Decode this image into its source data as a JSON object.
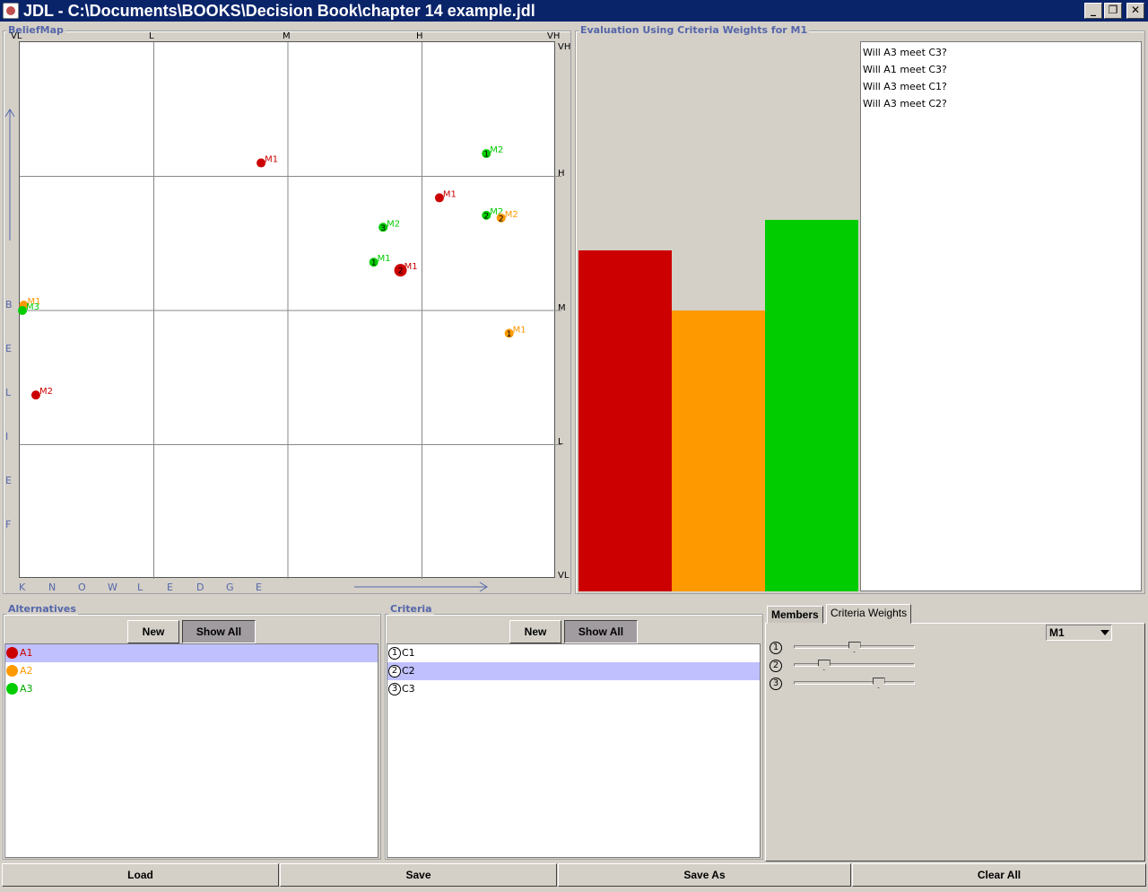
{
  "window": {
    "title": "JDL - C:\\Documents\\BOOKS\\Decision Book\\chapter 14 example.jdl",
    "minimize": "_",
    "restore": "❐",
    "close": "✕"
  },
  "belief_map": {
    "legend": "BeliefMap",
    "top_axis": [
      "VL",
      "L",
      "M",
      "H",
      "VH"
    ],
    "right_axis": [
      "VH",
      "H",
      "M",
      "L",
      "VL"
    ],
    "left_letters": [
      "B",
      "E",
      "L",
      "I",
      "E",
      "F"
    ],
    "bottom_letters": [
      "K",
      "N",
      "O",
      "W",
      "L",
      "E",
      "D",
      "G",
      "E"
    ],
    "chart_data": {
      "type": "scatter",
      "x_axis_ticks": [
        "VL",
        "L",
        "M",
        "H",
        "VH"
      ],
      "y_axis_ticks": [
        "VH",
        "H",
        "M",
        "L",
        "VL"
      ],
      "xlim": [
        0,
        4
      ],
      "ylim": [
        0,
        4
      ],
      "points": [
        {
          "member": "M1",
          "criterion": "",
          "color": "#cc0000",
          "x": 1.8,
          "y": 3.1
        },
        {
          "member": "M1",
          "criterion": "",
          "color": "#cc0000",
          "x": 3.13,
          "y": 2.84
        },
        {
          "member": "M1",
          "criterion": "2",
          "color": "#cc0000",
          "x": 2.84,
          "y": 2.3,
          "big": true
        },
        {
          "member": "M2",
          "criterion": "",
          "color": "#cc0000",
          "x": 0.12,
          "y": 1.37
        },
        {
          "member": "M2",
          "criterion": "1",
          "color": "#00cc00",
          "x": 3.48,
          "y": 3.17
        },
        {
          "member": "M2",
          "criterion": "2",
          "color": "#00cc00",
          "x": 3.48,
          "y": 2.71
        },
        {
          "member": "M2",
          "criterion": "3",
          "color": "#00cc00",
          "x": 2.71,
          "y": 2.62
        },
        {
          "member": "M1",
          "criterion": "1",
          "color": "#00cc00",
          "x": 2.64,
          "y": 2.36
        },
        {
          "member": "M2",
          "criterion": "2",
          "color": "#ff9900",
          "x": 3.59,
          "y": 2.69
        },
        {
          "member": "M1",
          "criterion": "1",
          "color": "#ff9900",
          "x": 3.65,
          "y": 1.83
        },
        {
          "member": "M1",
          "criterion": "",
          "color": "#ff9900",
          "x": 0.03,
          "y": 2.04
        },
        {
          "member": "M3",
          "criterion": "",
          "color": "#00cc00",
          "x": 0.02,
          "y": 2.0
        }
      ]
    }
  },
  "evaluation": {
    "legend": "Evaluation Using Criteria Weights for M1",
    "chart_data": {
      "type": "bar",
      "categories": [
        "A1",
        "A2",
        "A3"
      ],
      "values": [
        0.62,
        0.51,
        0.675
      ],
      "colors": [
        "#cc0000",
        "#ff9900",
        "#00cc00"
      ],
      "ylim": [
        0,
        1
      ]
    },
    "questions": [
      "Will A3 meet C3?",
      "Will A1 meet C3?",
      "Will A3 meet C1?",
      "Will A3 meet C2?"
    ]
  },
  "alternatives": {
    "legend": "Alternatives",
    "new_label": "New",
    "show_all_label": "Show All",
    "items": [
      {
        "label": "A1",
        "color": "#cc0000"
      },
      {
        "label": "A2",
        "color": "#ff9900"
      },
      {
        "label": "A3",
        "color": "#00cc00"
      }
    ]
  },
  "criteria": {
    "legend": "Criteria",
    "new_label": "New",
    "show_all_label": "Show All",
    "items": [
      {
        "num": "1",
        "label": "C1"
      },
      {
        "num": "2",
        "label": "C2"
      },
      {
        "num": "3",
        "label": "C3"
      }
    ]
  },
  "tabs": {
    "members": "Members",
    "criteria_weights": "Criteria Weights"
  },
  "weights": {
    "member_select": "M1",
    "sliders": [
      {
        "num": "1",
        "value": 0.5
      },
      {
        "num": "2",
        "value": 0.25
      },
      {
        "num": "3",
        "value": 0.7
      }
    ]
  },
  "footer": {
    "load": "Load",
    "save": "Save",
    "save_as": "Save As",
    "clear_all": "Clear All"
  }
}
